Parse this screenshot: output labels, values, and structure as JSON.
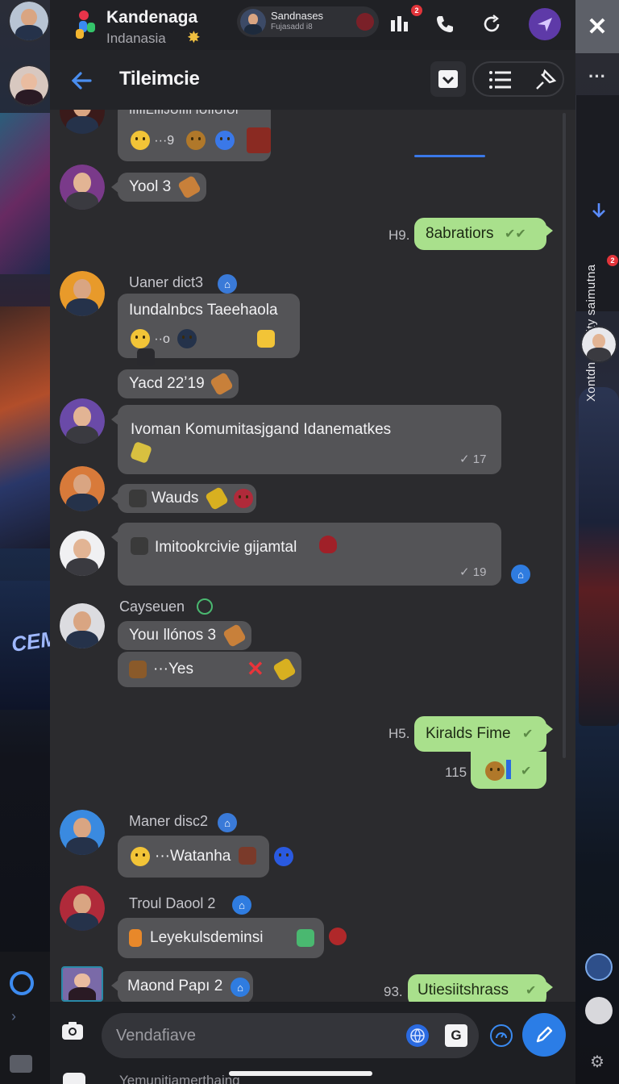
{
  "app": {
    "title": "Kandenaga",
    "subtitle": "Indanasia",
    "close_icon": "close-icon"
  },
  "active_chat_pill": {
    "name": "Sandnases",
    "sub": "Fujasadd i8"
  },
  "chat_header": {
    "title": "Tileimcie"
  },
  "right_panel": {
    "vertical_text": "Xontdn Qstaity saimutna",
    "badge_count": "2"
  },
  "top_badge": "2",
  "messages": {
    "m1": {
      "text": "IIIIIEIIIJUIIII IUIIUIUI",
      "time": "···9"
    },
    "m2": {
      "text": "Yool 3"
    },
    "m3": {
      "time": "H9.",
      "text": "8abratiors"
    },
    "m4": {
      "sender": "Uaner dict3",
      "text": "Iundalnbcs Taeehaola",
      "time": "··o"
    },
    "m5": {
      "text": "Yacd 22ʼ19"
    },
    "m6": {
      "text": "Ivoman Komumitasjgand Idanematkes",
      "time": "17"
    },
    "m7": {
      "text": "Wauds"
    },
    "m8": {
      "text": "Imitookrcivie gijamtal",
      "time": "19"
    },
    "m9": {
      "sender": "Cayseuen",
      "text": "Youı llónos 3"
    },
    "m10": {
      "text": "···Yes"
    },
    "m11": {
      "time": "H5.",
      "text": "Kiralds Fime"
    },
    "m12": {
      "time": "115"
    },
    "m13": {
      "sender": "Maner disc2",
      "text": "···Watanha"
    },
    "m14": {
      "sender": "Troul Daool 2",
      "text": "Leyekulsdeminsi"
    },
    "m15": {
      "sender": "Maond Papı 2"
    },
    "m16": {
      "time": "93.",
      "text": "Utiesiitshrass"
    }
  },
  "composer": {
    "placeholder": "Vendafiave",
    "second_line": "Yemunitiamerthaing"
  },
  "colors": {
    "incoming_bubble": "#545457",
    "outgoing_bubble": "#a9e08c",
    "accent": "#2b7de6",
    "background": "#2b2b2e"
  }
}
